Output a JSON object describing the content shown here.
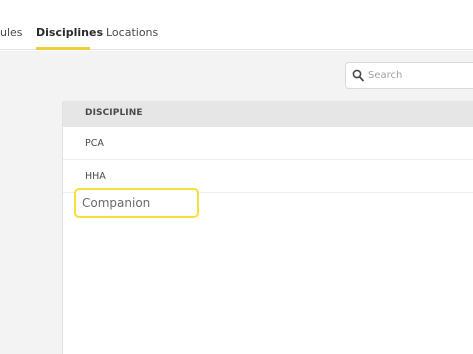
{
  "tabs": [
    {
      "label": "ules"
    },
    {
      "label": "Disciplines",
      "active": true
    },
    {
      "label": "Locations"
    }
  ],
  "search": {
    "placeholder": "Search",
    "value": "",
    "icon": "search-icon"
  },
  "table": {
    "column_header": "DISCIPLINE",
    "rows": [
      {
        "discipline": "PCA"
      },
      {
        "discipline": "HHA"
      }
    ]
  },
  "new_entry": {
    "value": "Companion"
  },
  "colors": {
    "accent": "#f3cc3a",
    "highlight_border": "#f3e13a",
    "header_bg": "#e6e6e6",
    "content_bg": "#f3f3f3"
  }
}
